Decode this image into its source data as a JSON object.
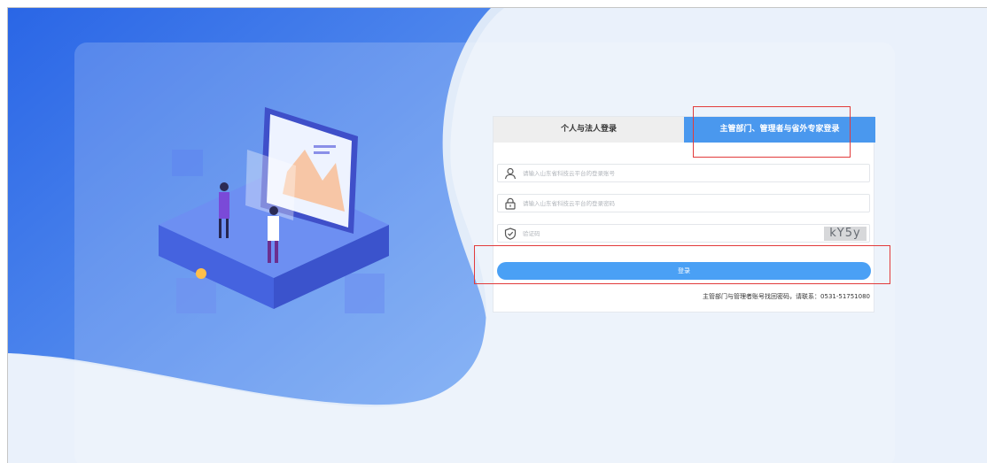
{
  "colors": {
    "bg_dark_blue": "#2f6fe8",
    "bg_light": "#d9e6f8",
    "tab_active": "#4a98ee",
    "login_button": "#4aa0f5",
    "highlight_red": "#e23b3b"
  },
  "login": {
    "tabs": [
      {
        "label": "个人与法人登录",
        "active": false
      },
      {
        "label": "主管部门、管理者与省外专家登录",
        "active": true
      }
    ],
    "account_placeholder": "请输入山东省科技云平台的登录账号",
    "password_placeholder": "请输入山东省科技云平台的登录密码",
    "captcha_placeholder": "验证码",
    "captcha_code": "kY5y",
    "login_button": "登录",
    "contact_text": "主管部门与管理者账号找回密码，请联系：0531-51751080"
  },
  "icons": {
    "account": "user-icon",
    "password": "lock-icon",
    "captcha": "shield-check-icon"
  }
}
